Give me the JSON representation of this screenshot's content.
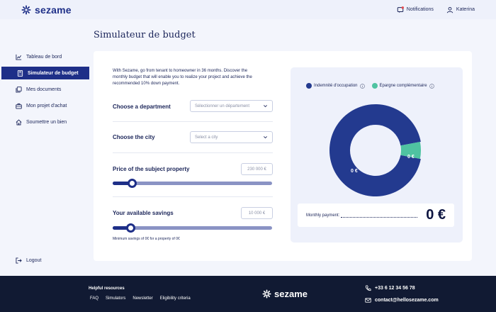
{
  "header": {
    "brand": "sezame",
    "notifications_label": "Notifications",
    "user_name": "Katerina"
  },
  "sidebar": {
    "items": [
      {
        "label": "Tableau de bord",
        "icon": "chart-icon"
      },
      {
        "label": "Simulateur de budget",
        "icon": "calculator-icon",
        "active": true
      },
      {
        "label": "Mes documents",
        "icon": "documents-icon"
      },
      {
        "label": "Mon projet d'achat",
        "icon": "briefcase-icon"
      },
      {
        "label": "Soumettre un bien",
        "icon": "home-icon"
      }
    ],
    "logout_label": "Logout"
  },
  "page_title": "Simulateur de budget",
  "form": {
    "intro": "With Sezame, go from tenant to homeowner in 36 months. Discover the monthly budget that will enable you to realize your project and achieve the recommended 10% down payment.",
    "department_label": "Choose a department",
    "department_placeholder": "Sélectionner un département",
    "city_label": "Choose the city",
    "city_placeholder": "Select a city",
    "price_label": "Price of the subject property",
    "price_placeholder": "230 000 €",
    "price_slider_fraction": 0.12,
    "savings_label": "Your available savings",
    "savings_placeholder": "10 000 €",
    "savings_slider_fraction": 0.11,
    "min_savings_note": "Minimum savings of 0€ for a property of 0€"
  },
  "results": {
    "legend": [
      {
        "label": "Indemnité d'occupation",
        "color": "#233a8f"
      },
      {
        "label": "Epargne complémentaire",
        "color": "#4fc3a1"
      }
    ],
    "donut_main_label": "0 €",
    "donut_small_label": "0 €",
    "donut_small_fraction": 0.06,
    "monthly_payment_label": "Monthly payment:",
    "monthly_payment_value": "0 €"
  },
  "footer": {
    "resources_title": "Helpful resources",
    "links": [
      "FAQ",
      "Simulators",
      "Newsletter",
      "Eligibility criteria"
    ],
    "brand": "sezame",
    "phone": "+33 6 12 34 56 78",
    "email": "contact@hellosezame.com"
  },
  "colors": {
    "primary": "#1e2f88",
    "accent": "#4fc3a1",
    "footer_bg": "#111a33"
  }
}
